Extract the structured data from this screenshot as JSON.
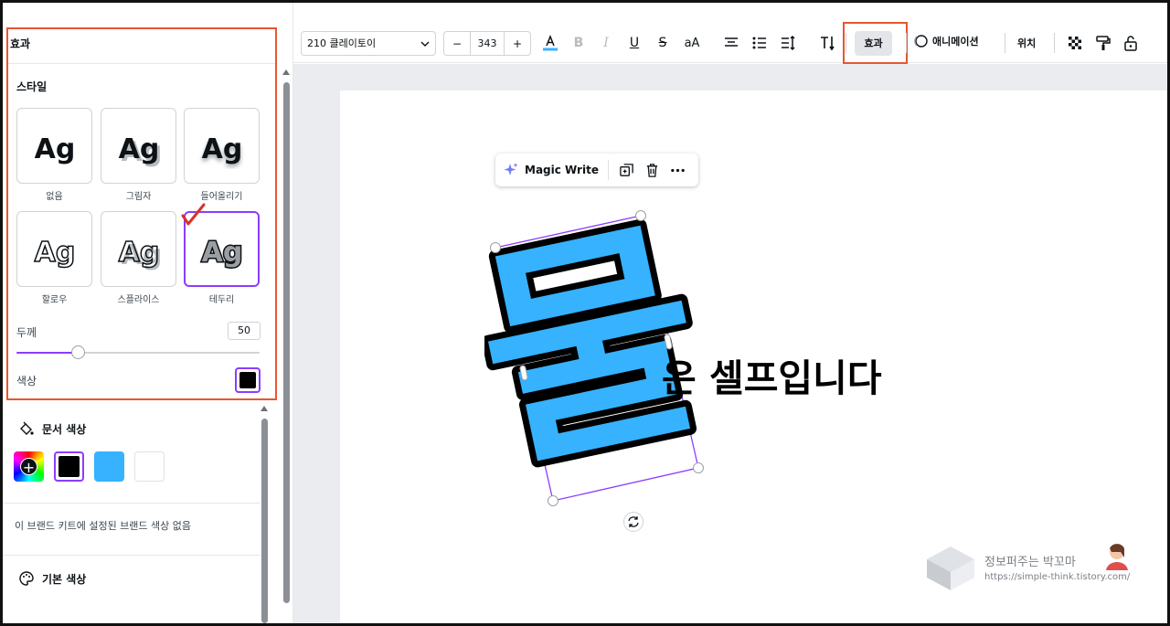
{
  "panel": {
    "title": "효과",
    "style_heading": "스타일",
    "styles": [
      {
        "label": "없음",
        "sample": "Ag"
      },
      {
        "label": "그림자",
        "sample": "Ag"
      },
      {
        "label": "들어올리기",
        "sample": "Ag"
      },
      {
        "label": "할로우",
        "sample": "Ag"
      },
      {
        "label": "스플라이스",
        "sample": "Ag"
      },
      {
        "label": "테두리",
        "sample": "Ag",
        "selected": true
      }
    ],
    "thickness_label": "두께",
    "thickness_value": "50",
    "thickness_percent": 0.25,
    "color_label": "색상",
    "color_value": "#000000"
  },
  "doc_colors": {
    "title": "문서 색상",
    "swatches": [
      "#000000",
      "#36b2ff",
      "#ffffff"
    ],
    "no_brand_text": "이 브랜드 키트에 설정된 브랜드 색상 없음"
  },
  "default_colors": {
    "title": "기본 색상"
  },
  "toolbar": {
    "font_name": "210 클레이토이",
    "size_minus": "−",
    "font_size": "343",
    "size_plus": "+",
    "text_color": "#36b2ff",
    "case_label": "aA",
    "effects_label": "효과",
    "animation_label": "애니메이션",
    "position_label": "위치"
  },
  "context_toolbar": {
    "magic_write_label": "Magic Write"
  },
  "canvas": {
    "big_char": "물",
    "rest_text": "은 셀프입니다",
    "big_char_fill": "#36b2ff"
  },
  "watermark": {
    "name": "정보퍼주는 박꼬마",
    "url": "https://simple-think.tistory.com/"
  },
  "colors": {
    "accent": "#8b3dff",
    "highlight": "#e8562e"
  }
}
